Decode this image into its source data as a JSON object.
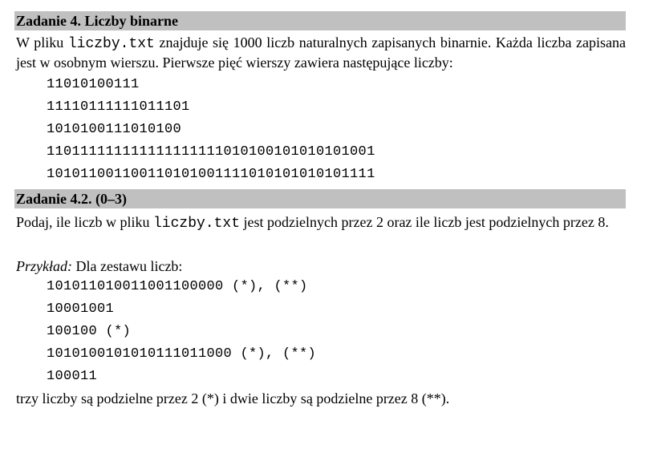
{
  "section1": {
    "title": "Zadanie 4. Liczby binarne",
    "intro_part1": "W pliku ",
    "filename": "liczby.txt",
    "intro_part2": " znajduje się 1000 liczb naturalnych zapisanych binarnie. Każda liczba zapisana jest w osobnym wierszu. Pierwsze pięć wierszy zawiera następujące liczby:",
    "numbers": [
      "11010100111",
      "11110111111011101",
      "1010100111010100",
      "110111111111111111111010100101010101001",
      "101011001100110101001111010101010101111"
    ]
  },
  "section2": {
    "title": "Zadanie 4.2. (0–3)",
    "task_part1": "Podaj, ile liczb w pliku ",
    "filename": "liczby.txt",
    "task_part2": " jest podzielnych przez 2 oraz ile liczb jest podzielnych przez 8.",
    "example_label": "Przykład:",
    "example_text": " Dla zestawu liczb:",
    "example_numbers": [
      "101011010011001100000 (*), (**)",
      "10001001",
      "100100 (*)",
      "1010100101010111011000 (*), (**)",
      "100011"
    ],
    "conclusion": "trzy liczby są podzielne przez 2 (*) i dwie liczby są podzielne przez 8 (**)."
  }
}
